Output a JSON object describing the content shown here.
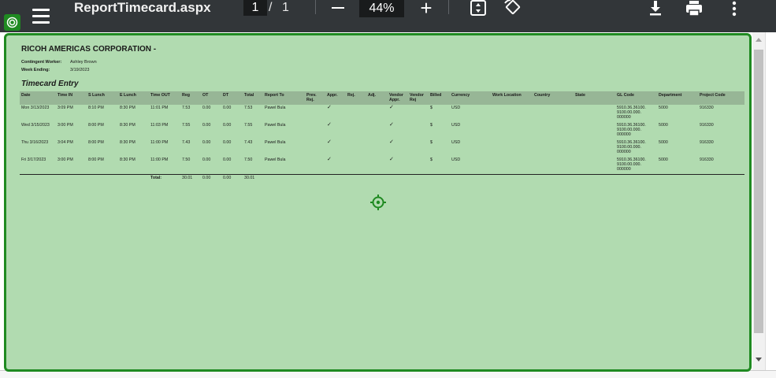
{
  "toolbar": {
    "title": "ReportTimecard.aspx",
    "current_page": "1",
    "page_separator": "/",
    "total_pages": "1",
    "zoom": "44%",
    "zoom_in_label": "+"
  },
  "report": {
    "company": "RICOH AMERICAS CORPORATION -",
    "worker_label": "Contingent Worker:",
    "worker_value": "Ashley Brown",
    "week_label": "Week Ending:",
    "week_value": "3/19/2023",
    "section_title": "Timecard Entry",
    "headers": {
      "date": "Date",
      "time_in": "Time IN",
      "s_lunch": "S Lunch",
      "e_lunch": "E Lunch",
      "time_out": "Time OUT",
      "reg": "Reg",
      "ot": "OT",
      "dt": "DT",
      "total": "Total",
      "report_to": "Report To",
      "prev_rej_1": "Prev.",
      "prev_rej_2": "Rej.",
      "appr": "Appr.",
      "rej": "Rej.",
      "adj": "Adj.",
      "vendor_appr_1": "Vendor",
      "vendor_appr_2": "Appr.",
      "vendor_rej_1": "Vendor",
      "vendor_rej_2": "Rej",
      "billed": "Billed",
      "currency": "Currency",
      "work_location": "Work Location",
      "country": "Country",
      "state": "State",
      "gl_code": "GL Code",
      "department": "Department",
      "project_code": "Project Code"
    },
    "rows": [
      {
        "date": "Mon 3/13/2023",
        "time_in": "3:09 PM",
        "s_lunch": "8:10 PM",
        "e_lunch": "8:30 PM",
        "time_out": "11:01 PM",
        "reg": "7.53",
        "ot": "0.00",
        "dt": "0.00",
        "total": "7.53",
        "report_to": "Pawel Bula",
        "appr": "✓",
        "vendor_appr": "✓",
        "billed": "$",
        "currency": "USD",
        "gl_1": "5910.36.36100.",
        "gl_2": "9100.00.000.",
        "gl_3": "000000",
        "department": "5000",
        "project_code": "916330"
      },
      {
        "date": "Wed 3/15/2023",
        "time_in": "3:00 PM",
        "s_lunch": "8:00 PM",
        "e_lunch": "8:30 PM",
        "time_out": "11:03 PM",
        "reg": "7.55",
        "ot": "0.00",
        "dt": "0.00",
        "total": "7.55",
        "report_to": "Pawel Bula",
        "appr": "✓",
        "vendor_appr": "✓",
        "billed": "$",
        "currency": "USD",
        "gl_1": "5910.36.36100.",
        "gl_2": "9100.00.000.",
        "gl_3": "000000",
        "department": "5000",
        "project_code": "916330"
      },
      {
        "date": "Thu 3/16/2023",
        "time_in": "3:04 PM",
        "s_lunch": "8:00 PM",
        "e_lunch": "8:30 PM",
        "time_out": "11:00 PM",
        "reg": "7.43",
        "ot": "0.00",
        "dt": "0.00",
        "total": "7.43",
        "report_to": "Pawel Bula",
        "appr": "✓",
        "vendor_appr": "✓",
        "billed": "$",
        "currency": "USD",
        "gl_1": "5910.36.36100.",
        "gl_2": "9100.00.000.",
        "gl_3": "000000",
        "department": "5000",
        "project_code": "916330"
      },
      {
        "date": "Fri 3/17/2023",
        "time_in": "3:00 PM",
        "s_lunch": "8:00 PM",
        "e_lunch": "8:30 PM",
        "time_out": "11:00 PM",
        "reg": "7.50",
        "ot": "0.00",
        "dt": "0.00",
        "total": "7.50",
        "report_to": "Pawel Bula",
        "appr": "✓",
        "vendor_appr": "✓",
        "billed": "$",
        "currency": "USD",
        "gl_1": "5910.36.36100.",
        "gl_2": "9100.00.000.",
        "gl_3": "000000",
        "department": "5000",
        "project_code": "916330"
      }
    ],
    "totals": {
      "label": "Total:",
      "reg": "30.01",
      "ot": "0.00",
      "dt": "0.00",
      "total": "30.01"
    }
  },
  "colors": {
    "toolbar_bg": "#323639",
    "highlight_fill": "#b1dbb0",
    "highlight_border": "#1f8a21",
    "header_row": "#97b696"
  }
}
